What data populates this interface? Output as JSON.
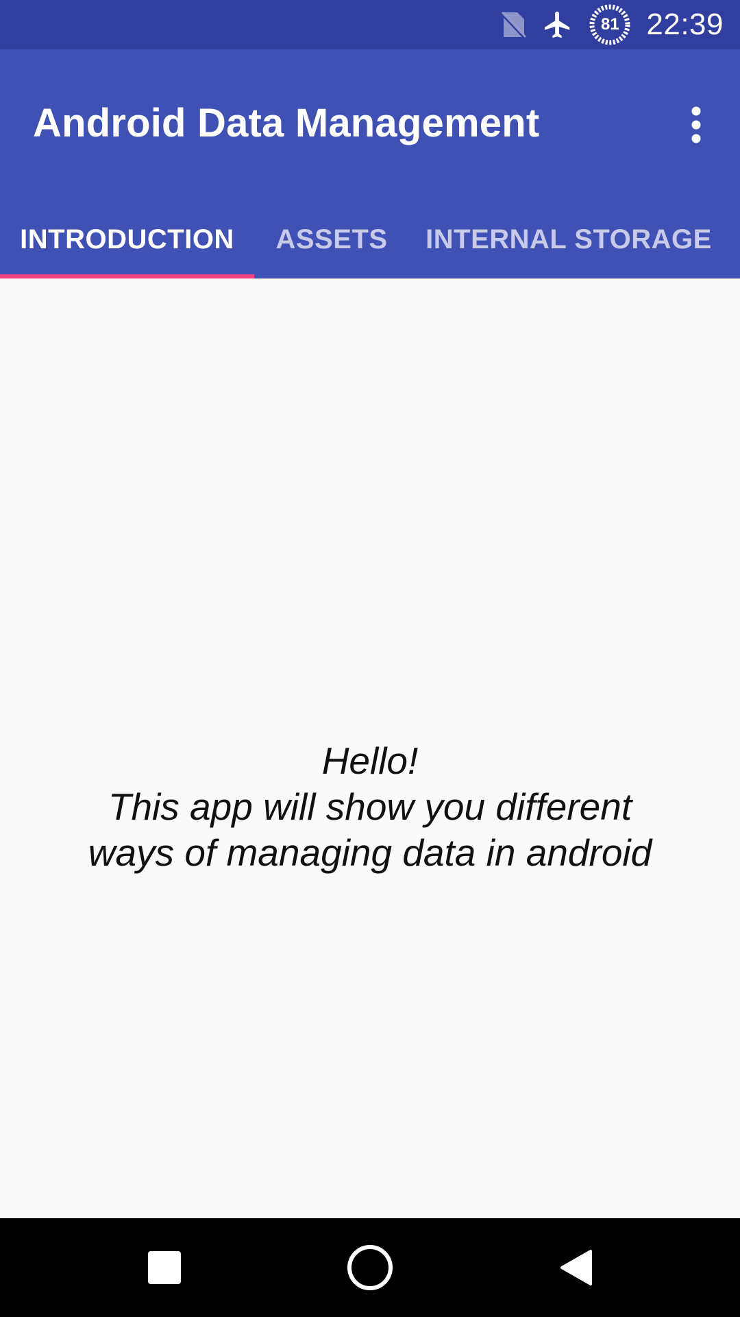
{
  "status_bar": {
    "time": "22:39",
    "battery_level": "81",
    "icons": [
      "no-sim-icon",
      "airplane-mode-icon",
      "battery-saver-icon"
    ]
  },
  "app_bar": {
    "title": "Android Data Management",
    "overflow_icon": "more-vert-icon",
    "color": "#3f51b5",
    "status_color": "#303f9f"
  },
  "tabs": [
    {
      "label": "INTRODUCTION",
      "active": true
    },
    {
      "label": "ASSETS",
      "active": false
    },
    {
      "label": "INTERNAL STORAGE",
      "active": false
    }
  ],
  "tab_indicator_color": "#ff4081",
  "content": {
    "line1": "Hello!",
    "line2": "This app will show you different",
    "line3": "ways of managing data in android"
  },
  "nav_bar": {
    "buttons": [
      "recents-icon",
      "home-icon",
      "back-icon"
    ]
  }
}
